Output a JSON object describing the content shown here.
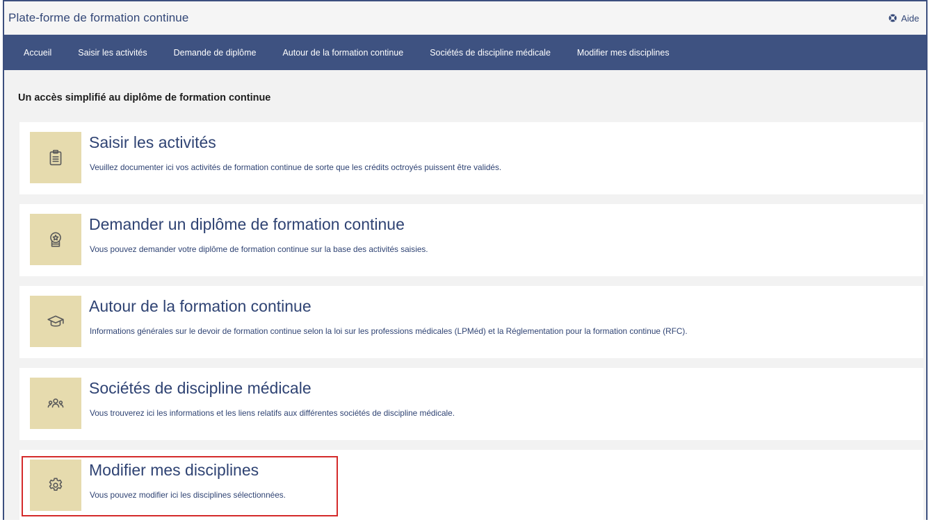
{
  "header": {
    "app_title": "Plate-forme de formation continue",
    "help_label": "Aide",
    "help_icon": "help-circle-icon"
  },
  "nav": {
    "items": [
      {
        "label": "Accueil"
      },
      {
        "label": "Saisir les activités"
      },
      {
        "label": "Demande de diplôme"
      },
      {
        "label": "Autour de la formation continue"
      },
      {
        "label": "Sociétés de discipline médicale"
      },
      {
        "label": "Modifier mes disciplines"
      }
    ]
  },
  "main": {
    "heading": "Un accès simplifié au diplôme de formation continue",
    "cards": [
      {
        "icon": "clipboard-icon",
        "title": "Saisir les activités",
        "description": "Veuillez documenter ici vos activités de formation continue de sorte que les crédits octroyés puissent être validés."
      },
      {
        "icon": "award-icon",
        "title": "Demander un diplôme de formation continue",
        "description": "Vous pouvez demander votre diplôme de formation continue sur la base des activités saisies."
      },
      {
        "icon": "graduation-cap-icon",
        "title": "Autour de la formation continue",
        "description": "Informations générales sur le devoir de formation continue selon la loi sur les professions médicales (LPMéd) et la Réglementation pour la formation continue (RFC)."
      },
      {
        "icon": "users-group-icon",
        "title": "Sociétés de discipline médicale",
        "description": "Vous trouverez ici les informations et les liens relatifs aux différentes sociétés de discipline médicale."
      },
      {
        "icon": "gear-icon",
        "title": "Modifier mes disciplines",
        "description": "Vous pouvez modifier ici les disciplines sélectionnées."
      }
    ]
  },
  "colors": {
    "nav_background": "#3e5281",
    "tile_background": "#e6dbae",
    "text_primary": "#2f4373",
    "highlight_border": "#d42a2a"
  }
}
